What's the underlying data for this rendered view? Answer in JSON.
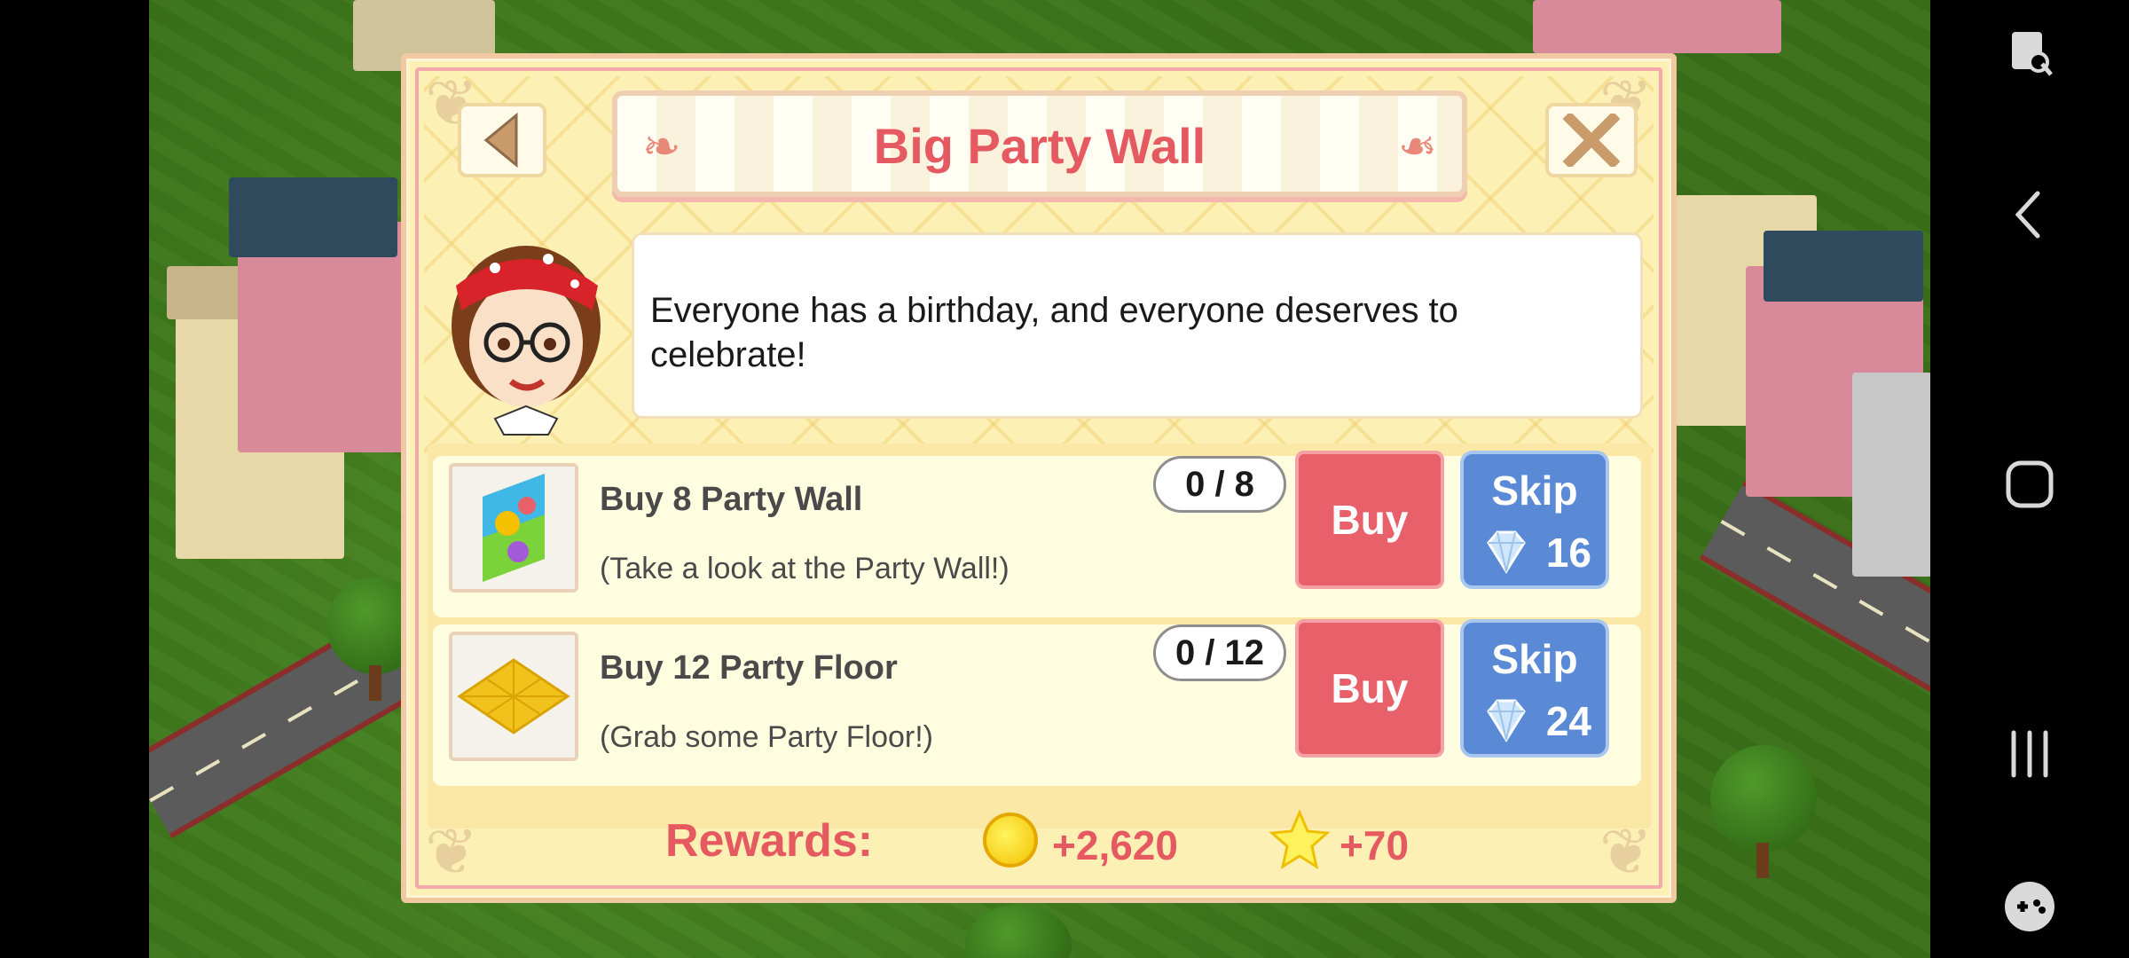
{
  "dialog": {
    "title": "Big Party Wall",
    "message": "Everyone has a birthday, and everyone deserves to celebrate!",
    "tasks": [
      {
        "title": "Buy 8 Party Wall",
        "description": "(Take a look at the Party Wall!)",
        "progress": "0 / 8",
        "buy_label": "Buy",
        "skip_label": "Skip",
        "skip_cost": "16",
        "thumb_icon": "party-wall-icon"
      },
      {
        "title": "Buy 12 Party Floor",
        "description": "(Grab some Party Floor!)",
        "progress": "0 / 12",
        "buy_label": "Buy",
        "skip_label": "Skip",
        "skip_cost": "24",
        "thumb_icon": "party-floor-icon"
      }
    ],
    "rewards": {
      "label": "Rewards:",
      "coins": "+2,620",
      "xp": "+70"
    }
  },
  "colors": {
    "title": "#e55a60",
    "buy": "#e8606a",
    "skip": "#5a8ad6",
    "dialog_bg": "#fdf0b5"
  },
  "system_nav": [
    "screenshot-lock-icon",
    "back-icon",
    "home-icon",
    "recents-icon",
    "game-tools-icon"
  ]
}
